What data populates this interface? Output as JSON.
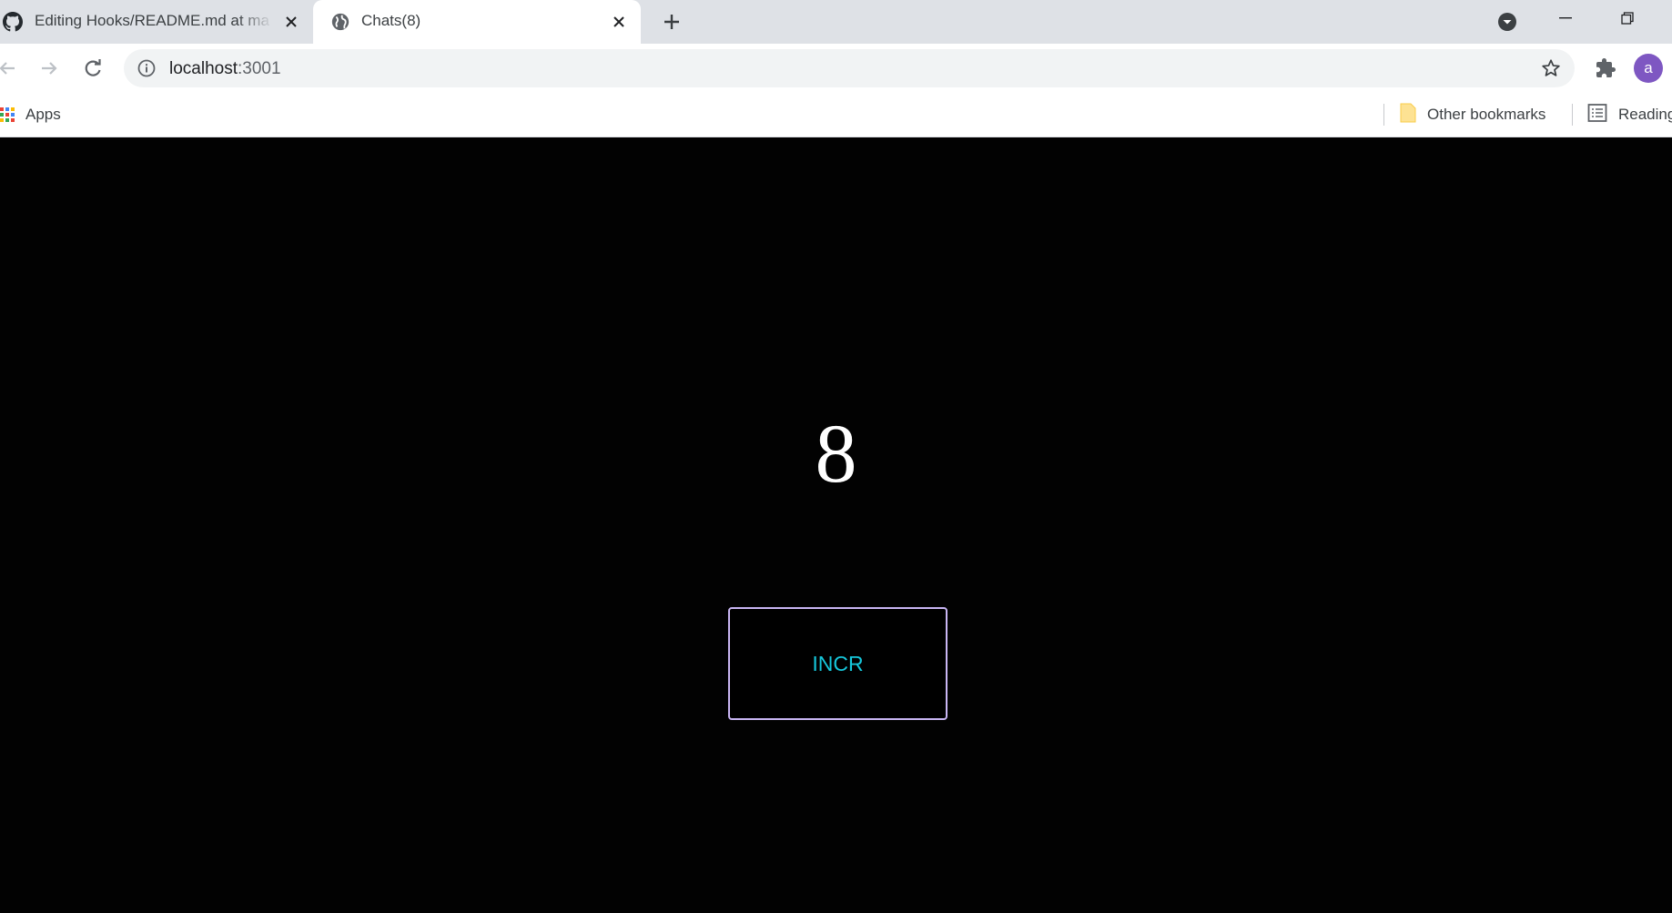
{
  "browser": {
    "tabs": [
      {
        "title": "Editing Hooks/README.md at ma",
        "favicon": "github-icon"
      },
      {
        "title": "Chats(8)",
        "favicon": "globe-icon",
        "active": true
      }
    ],
    "address_bar": {
      "host": "localhost",
      "port": ":3001"
    },
    "profile_initial": "a",
    "profile_color": "#7e57c2",
    "bookmarks": {
      "apps_label": "Apps",
      "other_label": "Other bookmarks",
      "reading_label": "Reading"
    }
  },
  "app": {
    "count": "8",
    "button_label": "INCR",
    "button_text_color": "#16c8dc",
    "button_border_color": "#c9b6f4",
    "background": "#020202"
  }
}
